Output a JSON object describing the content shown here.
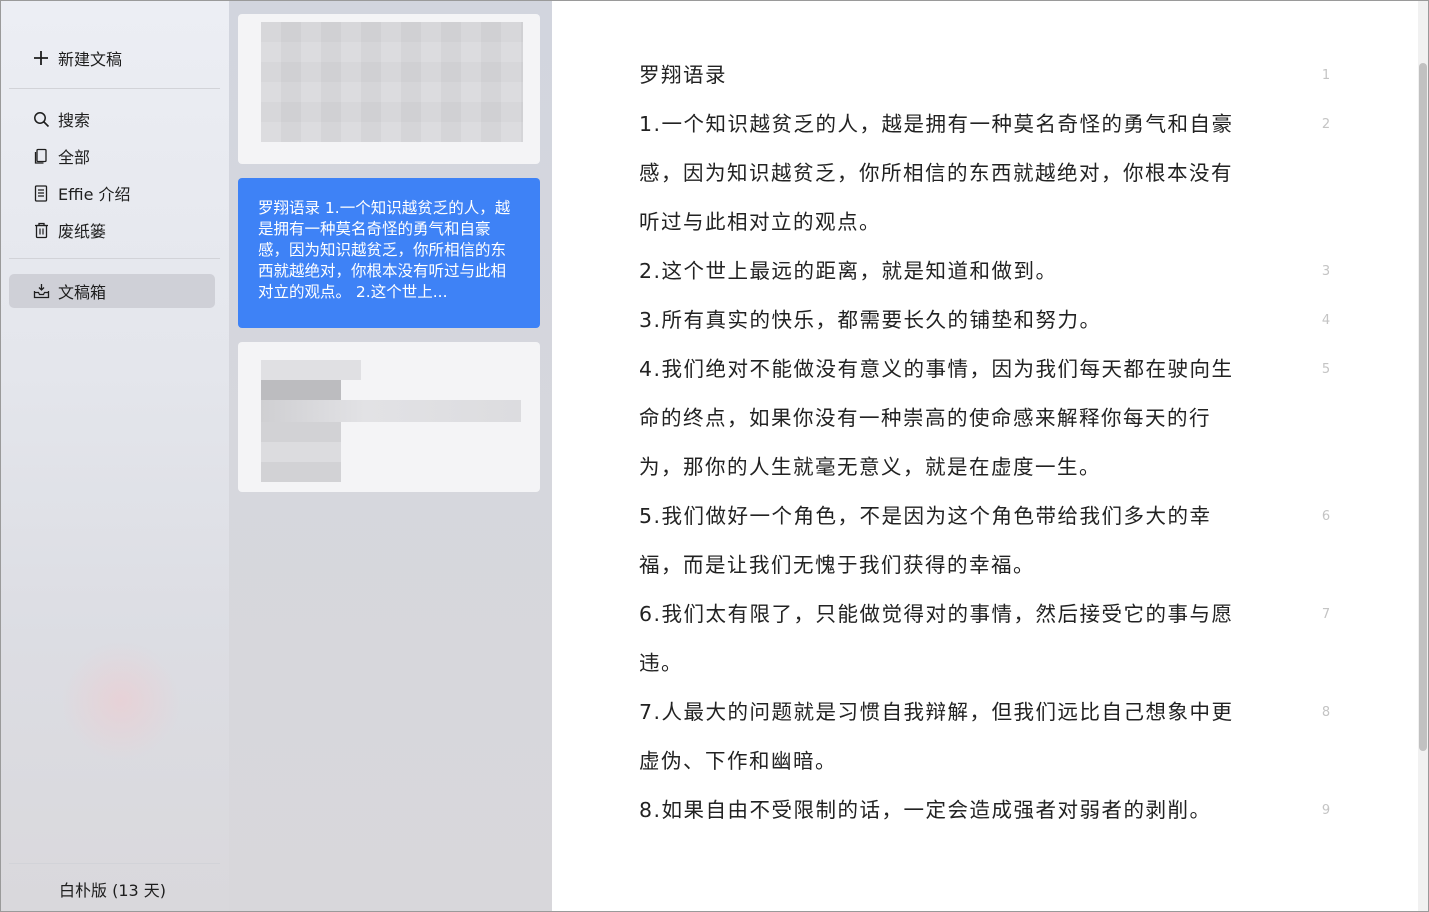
{
  "sidebar": {
    "new_doc_label": "新建文稿",
    "items": [
      {
        "label": "搜索",
        "icon": "search-icon"
      },
      {
        "label": "全部",
        "icon": "documents-icon"
      },
      {
        "label": "Effie 介绍",
        "icon": "document-icon"
      },
      {
        "label": "废纸篓",
        "icon": "trash-icon"
      }
    ],
    "inbox": {
      "label": "文稿箱",
      "icon": "inbox-icon"
    },
    "footer": "白朴版 (13 天)"
  },
  "list": {
    "selected_preview": "罗翔语录 1.一个知识越贫乏的人，越是拥有一种莫名奇怪的勇气和自豪感，因为知识越贫乏，你所相信的东西就越绝对，你根本没有听过与此相对立的观点。 2.这个世上..."
  },
  "editor": {
    "lines": [
      {
        "num": "1",
        "text": "罗翔语录"
      },
      {
        "num": "2",
        "text": "1.一个知识越贫乏的人，越是拥有一种莫名奇怪的勇气和自豪"
      },
      {
        "num": "",
        "text": "感，因为知识越贫乏，你所相信的东西就越绝对，你根本没有"
      },
      {
        "num": "",
        "text": "听过与此相对立的观点。"
      },
      {
        "num": "3",
        "text": "2.这个世上最远的距离，就是知道和做到。"
      },
      {
        "num": "4",
        "text": "3.所有真实的快乐，都需要长久的铺垫和努力。"
      },
      {
        "num": "5",
        "text": "4.我们绝对不能做没有意义的事情，因为我们每天都在驶向生"
      },
      {
        "num": "",
        "text": "命的终点，如果你没有一种崇高的使命感来解释你每天的行"
      },
      {
        "num": "",
        "text": "为，那你的人生就毫无意义，就是在虚度一生。"
      },
      {
        "num": "6",
        "text": "5.我们做好一个角色，不是因为这个角色带给我们多大的幸"
      },
      {
        "num": "",
        "text": "福，而是让我们无愧于我们获得的幸福。"
      },
      {
        "num": "7",
        "text": "6.我们太有限了，只能做觉得对的事情，然后接受它的事与愿"
      },
      {
        "num": "",
        "text": "违。"
      },
      {
        "num": "8",
        "text": "7.人最大的问题就是习惯自我辩解，但我们远比自己想象中更"
      },
      {
        "num": "",
        "text": "虚伪、下作和幽暗。"
      },
      {
        "num": "9",
        "text": "8.如果自由不受限制的话，一定会造成强者对弱者的剥削。"
      }
    ]
  },
  "colors": {
    "accent": "#3e82f6",
    "sidebar_bg": "#e8e9ef",
    "list_bg": "#d4d6de",
    "text": "#222222",
    "line_number": "#c4c4c4"
  }
}
